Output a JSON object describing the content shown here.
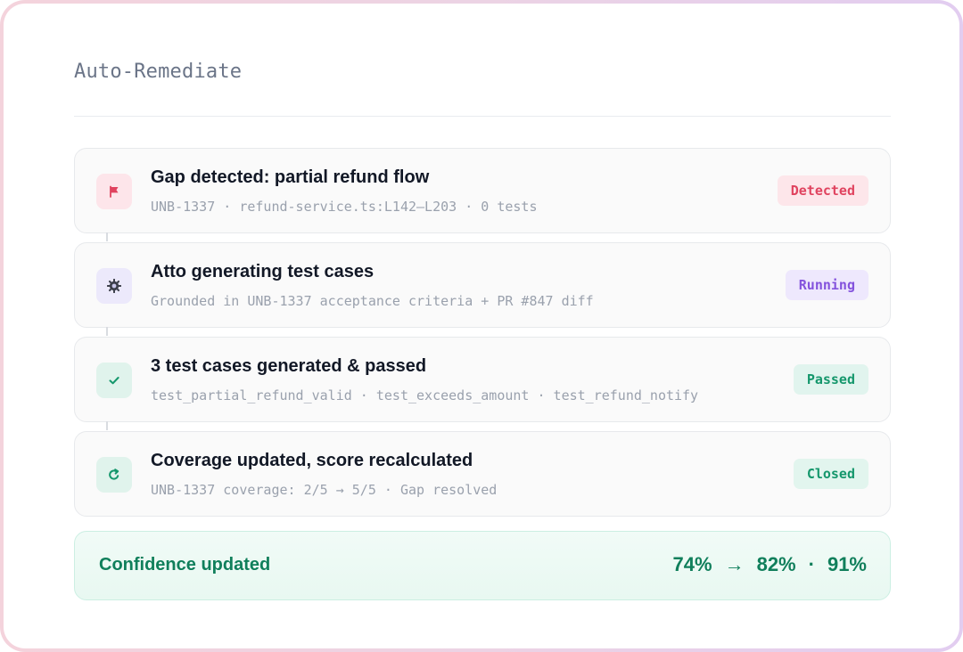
{
  "panel": {
    "title": "Auto-Remediate"
  },
  "steps": [
    {
      "icon": "flag-icon",
      "title": "Gap detected: partial refund flow",
      "subtitle": "UNB-1337 · refund-service.ts:L142–L203 · 0 tests",
      "status": "Detected",
      "color": "#e0435f"
    },
    {
      "icon": "gear-icon",
      "title": "Atto generating test cases",
      "subtitle": "Grounded in UNB-1337 acceptance criteria + PR #847 diff",
      "status": "Running",
      "color": "#8453dd"
    },
    {
      "icon": "check-icon",
      "title": "3 test cases generated & passed",
      "subtitle": "test_partial_refund_valid · test_exceeds_amount · test_refund_notify",
      "status": "Passed",
      "color": "#15976c"
    },
    {
      "icon": "refresh-icon",
      "title": "Coverage updated, score recalculated",
      "subtitle": "UNB-1337 coverage: 2/5 → 5/5 · Gap resolved",
      "status": "Closed",
      "color": "#15976c"
    }
  ],
  "confidence": {
    "label": "Confidence updated",
    "from": "74%",
    "arrow": "→",
    "to": "82%",
    "separator": "·",
    "target": "91%",
    "color": "#107f5b"
  }
}
